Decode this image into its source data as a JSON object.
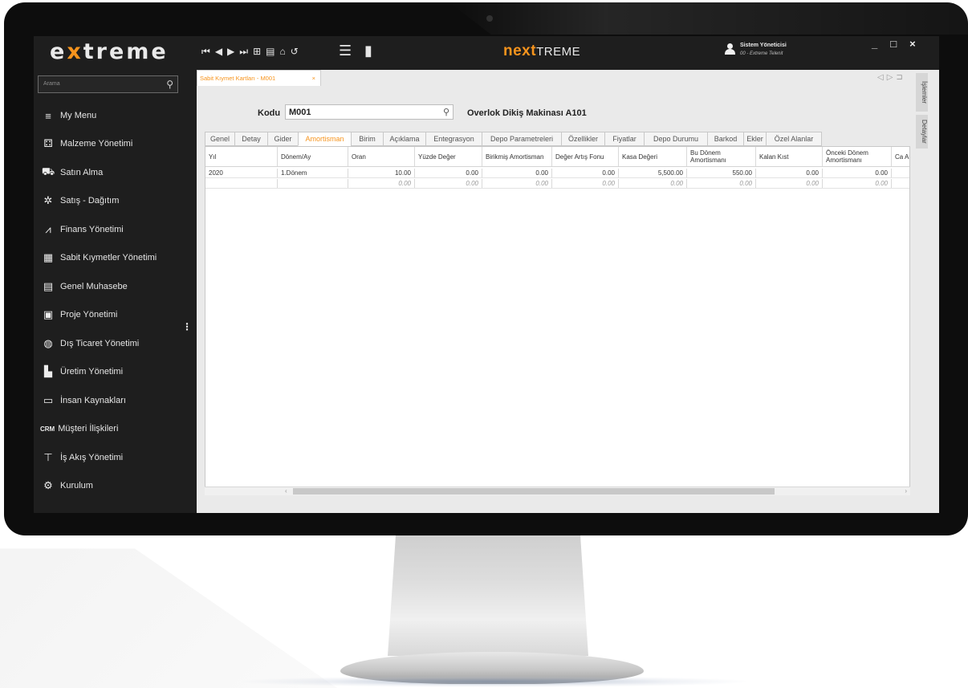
{
  "app": {
    "logo": {
      "prefix": "e",
      "accent": "x",
      "suffix": "treme"
    },
    "brand": {
      "next": "next",
      "treme": "TREME"
    },
    "user": {
      "name": "Sistem Yöneticisi",
      "subtitle": "00 - Extreme Telenit"
    },
    "window_controls": {
      "minimize": "_",
      "maximize": "□",
      "close": "×"
    },
    "nav_icons": [
      "first-record-icon",
      "prev-record-icon",
      "next-record-icon",
      "last-record-icon",
      "new-record-icon",
      "save-icon",
      "delete-icon",
      "undo-icon"
    ],
    "colors": {
      "accent": "#f7941d",
      "chrome": "#1e1e1e",
      "content_bg": "#eaeaea"
    }
  },
  "sidebar": {
    "search_placeholder": "Arama",
    "items": [
      {
        "label": "My Menu",
        "icon": "my-menu-icon"
      },
      {
        "label": "Malzeme Yönetimi",
        "icon": "materials-icon"
      },
      {
        "label": "Satın Alma",
        "icon": "cart-icon"
      },
      {
        "label": "Satış - Dağıtım",
        "icon": "distribution-icon"
      },
      {
        "label": "Finans Yönetimi",
        "icon": "finance-chart-icon"
      },
      {
        "label": "Sabit Kıymetler Yönetimi",
        "icon": "fixed-assets-icon"
      },
      {
        "label": "Genel Muhasebe",
        "icon": "ledger-icon"
      },
      {
        "label": "Proje Yönetimi",
        "icon": "project-icon"
      },
      {
        "label": "Dış Ticaret Yönetimi",
        "icon": "globe-icon"
      },
      {
        "label": "Üretim Yönetimi",
        "icon": "factory-icon"
      },
      {
        "label": "İnsan Kaynakları",
        "icon": "id-card-icon"
      },
      {
        "label": "Müşteri İlişkileri",
        "icon": "crm-icon",
        "badge": "CRM"
      },
      {
        "label": "İş Akış Yönetimi",
        "icon": "workflow-icon"
      },
      {
        "label": "Kurulum",
        "icon": "gear-icon"
      }
    ]
  },
  "document": {
    "tab_label": "Sabit Kıymet Kartları - M001",
    "tab_close": "×",
    "side_tabs": [
      "İşlemler",
      "Detaylar"
    ],
    "kodu_label": "Kodu",
    "kodu_value": "M001",
    "product_name": "Overlok Dikiş Makinası A101",
    "tabs": [
      "Genel",
      "Detay",
      "Gider",
      "Amortisman",
      "Birim",
      "Açıklama",
      "Entegrasyon",
      "Depo Parametreleri",
      "Özellikler",
      "Fiyatlar",
      "Depo Durumu",
      "Barkod",
      "Ekler",
      "Özel Alanlar"
    ],
    "active_tab": "Amortisman"
  },
  "grid": {
    "columns": [
      "Yıl",
      "Dönem/Ay",
      "Oran",
      "Yüzde Değer",
      "Birikmiş Amortisman",
      "Değer Artış Fonu",
      "Kasa Değeri",
      "Bu Dönem Amortismanı",
      "Kalan Kıst",
      "Önceki Dönem Amortismanı",
      "Ca Ar"
    ],
    "rows": [
      [
        "2020",
        "1.Dönem",
        "10.00",
        "0.00",
        "0.00",
        "0.00",
        "5,500.00",
        "550.00",
        "0.00",
        "0.00",
        ""
      ]
    ],
    "totals": [
      "",
      "",
      "0.00",
      "0.00",
      "0.00",
      "0.00",
      "0.00",
      "0.00",
      "0.00",
      "0.00",
      ""
    ]
  }
}
